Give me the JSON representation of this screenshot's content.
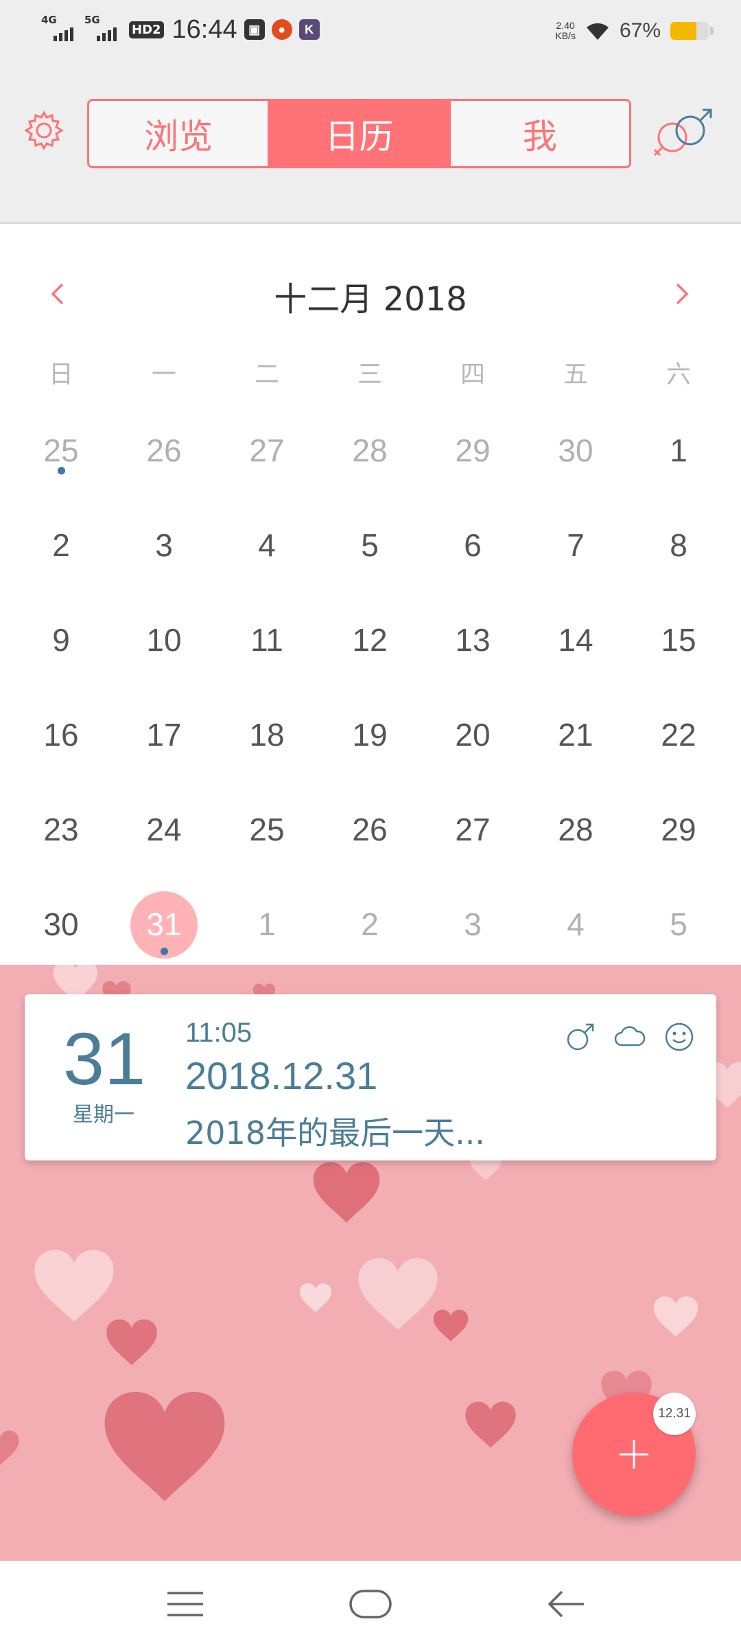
{
  "status_bar": {
    "net1": "4G",
    "net2": "5G",
    "hd": "HD2",
    "time": "16:44",
    "speed_value": "2.40",
    "speed_unit": "KB/s",
    "battery_text": "67%",
    "battery_level": 0.67
  },
  "header": {
    "tabs": [
      {
        "label": "浏览",
        "active": false
      },
      {
        "label": "日历",
        "active": true
      },
      {
        "label": "我",
        "active": false
      }
    ],
    "settings_icon": "gear-icon",
    "gender_icon": "gender-icon"
  },
  "calendar": {
    "month_title": "十二月 2018",
    "weekdays": [
      "日",
      "一",
      "二",
      "三",
      "四",
      "五",
      "六"
    ],
    "weeks": [
      [
        "25",
        "26",
        "27",
        "28",
        "29",
        "30",
        "1"
      ],
      [
        "2",
        "3",
        "4",
        "5",
        "6",
        "7",
        "8"
      ],
      [
        "9",
        "10",
        "11",
        "12",
        "13",
        "14",
        "15"
      ],
      [
        "16",
        "17",
        "18",
        "19",
        "20",
        "21",
        "22"
      ],
      [
        "23",
        "24",
        "25",
        "26",
        "27",
        "28",
        "29"
      ],
      [
        "30",
        "31",
        "1",
        "2",
        "3",
        "4",
        "5"
      ]
    ],
    "selected_day": "31"
  },
  "entry": {
    "day": "31",
    "weekday": "星期一",
    "time": "11:05",
    "date": "2018.12.31",
    "text": "2018年的最后一天..."
  },
  "fab": {
    "badge": "12.31",
    "icon": "plus-icon"
  },
  "colors": {
    "accent": "#ff7377",
    "entry_text": "#4b7d98",
    "pink_bg": "#f2aeb3"
  }
}
